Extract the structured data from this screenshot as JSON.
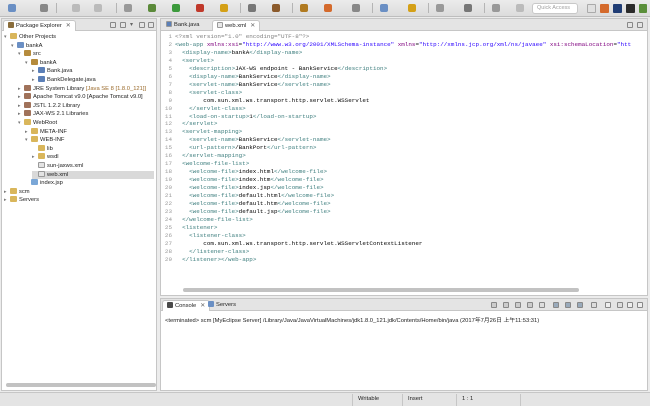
{
  "toolbar": {
    "quick_access_placeholder": "Quick Access"
  },
  "explorer": {
    "title": "Package Explorer",
    "items": [
      {
        "label": "Other Projects",
        "depth": 0,
        "arrow": "▾",
        "icon": "folder"
      },
      {
        "label": "bankA",
        "depth": 1,
        "arrow": "▾",
        "icon": "project"
      },
      {
        "label": "src",
        "depth": 2,
        "arrow": "▾",
        "icon": "src"
      },
      {
        "label": "bankA",
        "depth": 3,
        "arrow": "▾",
        "icon": "package"
      },
      {
        "label": "Bank.java",
        "depth": 4,
        "arrow": "▸",
        "icon": "java"
      },
      {
        "label": "BankDelegate.java",
        "depth": 4,
        "arrow": "▸",
        "icon": "java"
      },
      {
        "label": "JRE System Library",
        "extra": " [Java SE 8 [1.8.0_121]]",
        "depth": 2,
        "arrow": "▸",
        "icon": "lib"
      },
      {
        "label": "Apache Tomcat v9.0 [Apache Tomcat v9.0]",
        "depth": 2,
        "arrow": "▸",
        "icon": "lib"
      },
      {
        "label": "JSTL 1.2.2 Library",
        "depth": 2,
        "arrow": "▸",
        "icon": "lib"
      },
      {
        "label": "JAX-WS 2.1 Libraries",
        "depth": 2,
        "arrow": "▸",
        "icon": "lib"
      },
      {
        "label": "WebRoot",
        "depth": 2,
        "arrow": "▾",
        "icon": "folder"
      },
      {
        "label": "META-INF",
        "depth": 3,
        "arrow": "▸",
        "icon": "folder"
      },
      {
        "label": "WEB-INF",
        "depth": 3,
        "arrow": "▾",
        "icon": "folder"
      },
      {
        "label": "lib",
        "depth": 4,
        "arrow": "",
        "icon": "folder"
      },
      {
        "label": "wsdl",
        "depth": 4,
        "arrow": "▸",
        "icon": "folder"
      },
      {
        "label": "sun-jaxws.xml",
        "depth": 4,
        "arrow": "",
        "icon": "xml"
      },
      {
        "label": "web.xml",
        "depth": 4,
        "arrow": "",
        "icon": "xml",
        "selected": true
      },
      {
        "label": "index.jsp",
        "depth": 3,
        "arrow": "",
        "icon": "jsp"
      },
      {
        "label": "scm",
        "depth": 0,
        "arrow": "▸",
        "icon": "folder"
      },
      {
        "label": "Servers",
        "depth": 0,
        "arrow": "▸",
        "icon": "folder"
      }
    ]
  },
  "editor": {
    "tabs": [
      {
        "label": "Bank.java",
        "active": false
      },
      {
        "label": "web.xml",
        "active": true
      }
    ],
    "lines": [
      {
        "n": "1",
        "t": "<?xml version=\"1.0\" encoding=\"UTF-8\"?>"
      },
      {
        "n": "2",
        "t": "<web-app xmlns:xsi=\"http://www.w3.org/2001/XMLSchema-instance\" xmlns=\"http://xmlns.jcp.org/xml/ns/javaee\" xsi:schemaLocation=\"htt"
      },
      {
        "n": "3",
        "t": "  <display-name>bankA</display-name>"
      },
      {
        "n": "4",
        "t": "  <servlet>"
      },
      {
        "n": "5",
        "t": "    <description>JAX-WS endpoint - BankService</description>"
      },
      {
        "n": "6",
        "t": "    <display-name>BankService</display-name>"
      },
      {
        "n": "7",
        "t": "    <servlet-name>BankService</servlet-name>"
      },
      {
        "n": "8",
        "t": "    <servlet-class>"
      },
      {
        "n": "9",
        "t": "        com.sun.xml.ws.transport.http.servlet.WSServlet"
      },
      {
        "n": "10",
        "t": "    </servlet-class>"
      },
      {
        "n": "11",
        "t": "    <load-on-startup>1</load-on-startup>"
      },
      {
        "n": "12",
        "t": "  </servlet>"
      },
      {
        "n": "13",
        "t": "  <servlet-mapping>"
      },
      {
        "n": "14",
        "t": "    <servlet-name>BankService</servlet-name>"
      },
      {
        "n": "15",
        "t": "    <url-pattern>/BankPort</url-pattern>"
      },
      {
        "n": "16",
        "t": "  </servlet-mapping>"
      },
      {
        "n": "17",
        "t": "  <welcome-file-list>"
      },
      {
        "n": "18",
        "t": "    <welcome-file>index.html</welcome-file>"
      },
      {
        "n": "19",
        "t": "    <welcome-file>index.htm</welcome-file>"
      },
      {
        "n": "20",
        "t": "    <welcome-file>index.jsp</welcome-file>"
      },
      {
        "n": "21",
        "t": "    <welcome-file>default.html</welcome-file>"
      },
      {
        "n": "22",
        "t": "    <welcome-file>default.htm</welcome-file>"
      },
      {
        "n": "23",
        "t": "    <welcome-file>default.jsp</welcome-file>"
      },
      {
        "n": "24",
        "t": "  </welcome-file-list>"
      },
      {
        "n": "25",
        "t": "  <listener>"
      },
      {
        "n": "26",
        "t": "    <listener-class>"
      },
      {
        "n": "27",
        "t": "        com.sun.xml.ws.transport.http.servlet.WSServletContextListener"
      },
      {
        "n": "28",
        "t": "    </listener-class>"
      },
      {
        "n": "29",
        "t": "  </listener></web-app>"
      }
    ]
  },
  "console": {
    "tabs": [
      {
        "label": "Console",
        "active": true
      },
      {
        "label": "Servers",
        "active": false
      }
    ],
    "text": "<terminated> scm [MyEclipse Server] /Library/Java/JavaVirtualMachines/jdk1.8.0_121.jdk/Contents/Home/bin/java (2017年7月26日 上午11:53:31)"
  },
  "status": {
    "writable": "Writable",
    "insert": "Insert",
    "position": "1 : 1"
  },
  "colors": {
    "tag": "#3f7f7f",
    "attr": "#7f007f",
    "value": "#2a00ff",
    "text": "#000000",
    "decl": "#808080",
    "selection": "#d9d9d9"
  }
}
